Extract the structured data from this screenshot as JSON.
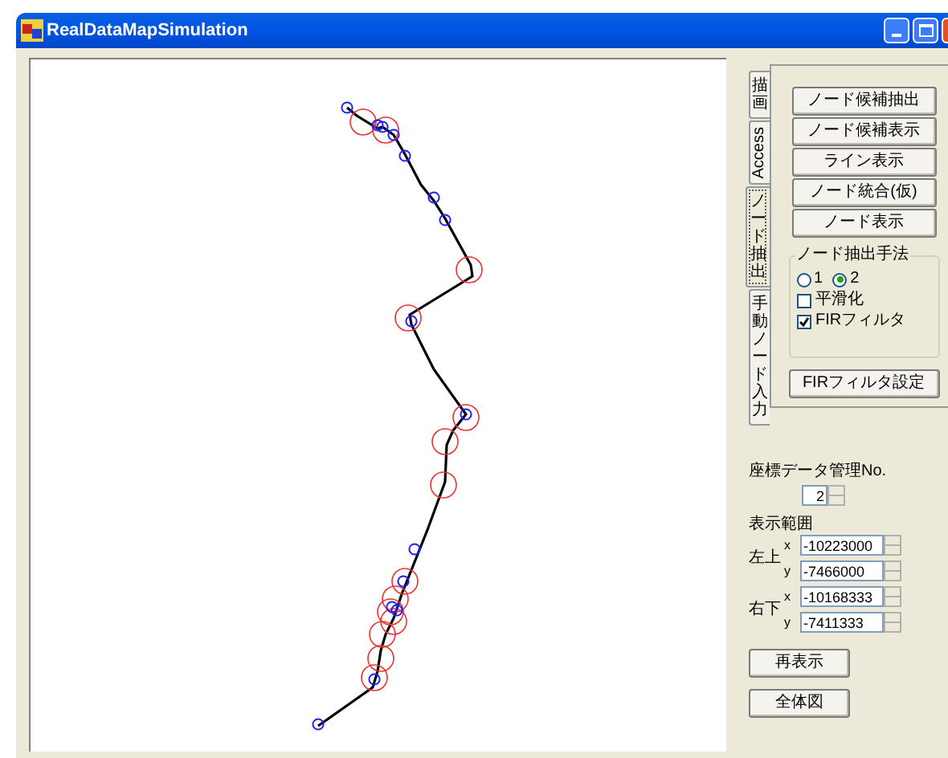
{
  "window": {
    "title": "RealDataMapSimulation"
  },
  "tabs": [
    {
      "label": "描画",
      "kind": "stacked",
      "selected": false
    },
    {
      "label": "Access",
      "kind": "rotated",
      "selected": false
    },
    {
      "label": "ノード抽出",
      "kind": "stacked",
      "selected": true
    },
    {
      "label": "手動ノード入力",
      "kind": "stacked",
      "selected": false
    }
  ],
  "tab_buttons": [
    "ノード候補抽出",
    "ノード候補表示",
    "ライン表示",
    "ノード統合(仮)",
    "ノード表示"
  ],
  "method_group": {
    "title": "ノード抽出手法",
    "radios": [
      {
        "label": "1",
        "selected": false
      },
      {
        "label": "2",
        "selected": true
      }
    ],
    "checkboxes": [
      {
        "label": "平滑化",
        "checked": false
      },
      {
        "label": "FIRフィルタ",
        "checked": true
      }
    ]
  },
  "fir_button": "FIRフィルタ設定",
  "data_no": {
    "label": "座標データ管理No.",
    "value": "2"
  },
  "range": {
    "title": "表示範囲",
    "groups": [
      {
        "label": "左上",
        "fields": [
          {
            "axis": "x",
            "value": "-10223000"
          },
          {
            "axis": "y",
            "value": "-7466000"
          }
        ]
      },
      {
        "label": "右下",
        "fields": [
          {
            "axis": "x",
            "value": "-10168333"
          },
          {
            "axis": "y",
            "value": "-7411333"
          }
        ]
      }
    ]
  },
  "buttons": [
    "再表示",
    "全体図"
  ]
}
